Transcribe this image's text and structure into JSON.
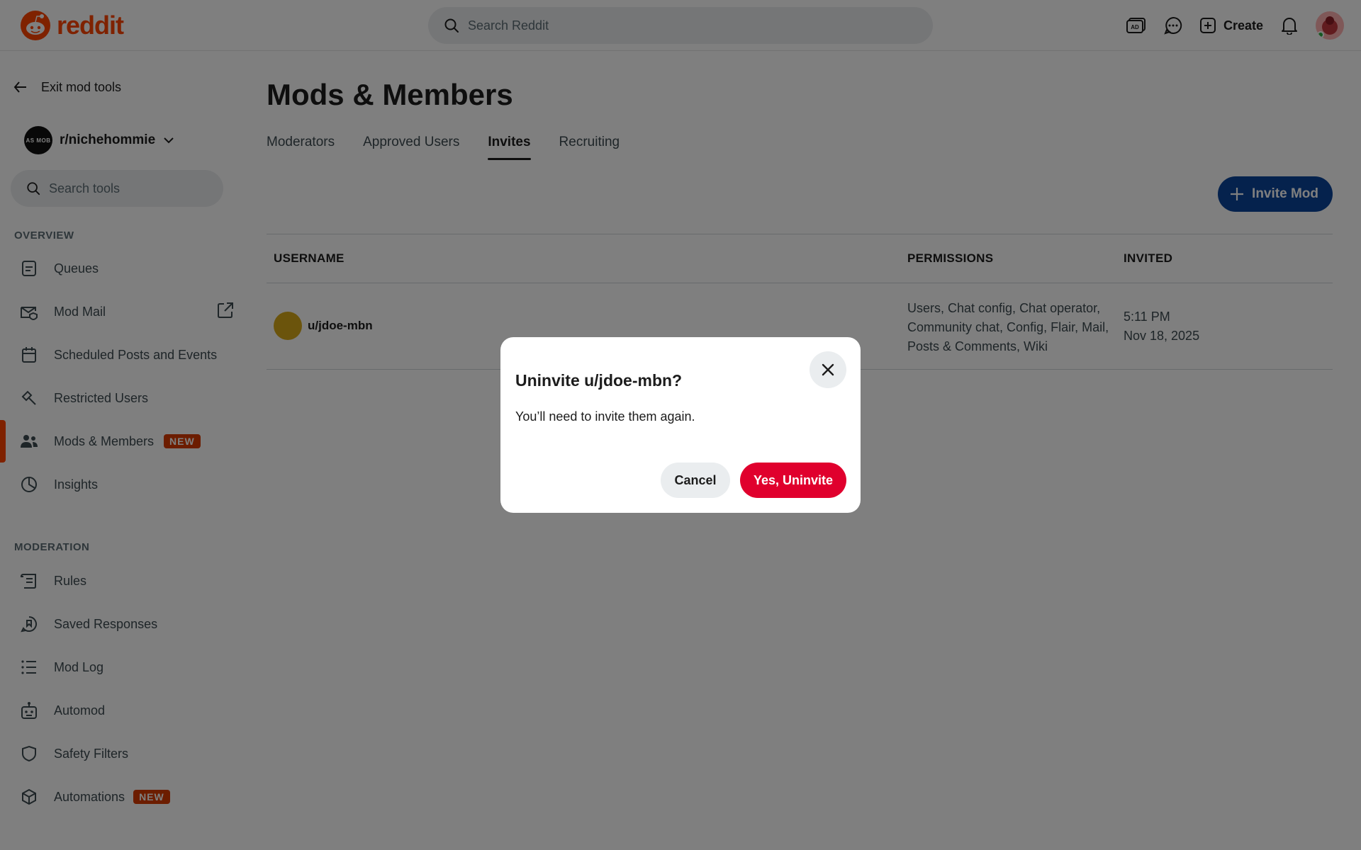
{
  "header": {
    "logo_text": "reddit",
    "search_placeholder": "Search Reddit",
    "create_label": "Create"
  },
  "sidebar": {
    "exit_label": "Exit mod tools",
    "subreddit": "r/nichehommie",
    "subreddit_avatar_text": "AS MOB",
    "search_placeholder": "Search tools",
    "overview_heading": "OVERVIEW",
    "moderation_heading": "MODERATION",
    "badge_new": "NEW",
    "overview_items": [
      {
        "label": "Queues",
        "icon": "queue-icon"
      },
      {
        "label": "Mod Mail",
        "icon": "mail-icon"
      },
      {
        "label": "Scheduled Posts and Events",
        "icon": "calendar-icon"
      },
      {
        "label": "Restricted Users",
        "icon": "hammer-icon"
      },
      {
        "label": "Mods & Members",
        "icon": "users-icon"
      },
      {
        "label": "Insights",
        "icon": "pie-chart-icon"
      }
    ],
    "moderation_items": [
      {
        "label": "Rules",
        "icon": "rules-icon"
      },
      {
        "label": "Saved Responses",
        "icon": "saved-responses-icon"
      },
      {
        "label": "Mod Log",
        "icon": "list-icon"
      },
      {
        "label": "Automod",
        "icon": "robot-icon"
      },
      {
        "label": "Safety Filters",
        "icon": "shield-icon"
      },
      {
        "label": "Automations",
        "icon": "cube-icon"
      }
    ]
  },
  "main": {
    "title": "Mods & Members",
    "tabs": [
      "Moderators",
      "Approved Users",
      "Invites",
      "Recruiting"
    ],
    "active_tab": "Invites",
    "invite_button": "Invite Mod",
    "columns": {
      "username": "USERNAME",
      "permissions": "PERMISSIONS",
      "invited": "INVITED"
    },
    "rows": [
      {
        "username": "u/jdoe-mbn",
        "permissions_line1": "Users, Chat config, Chat operator,",
        "permissions_line2": "Community chat, Config, Flair, Mail,",
        "permissions_line3": "Posts & Comments, Wiki",
        "invited_time": "5:11 PM",
        "invited_date": "Nov 18, 2025"
      }
    ]
  },
  "modal": {
    "title": "Uninvite u/jdoe-mbn?",
    "body": "You’ll need to invite them again.",
    "cancel_label": "Cancel",
    "confirm_label": "Yes, Uninvite"
  },
  "colors": {
    "brand": "#ff4500",
    "primary_button": "#0a449b",
    "danger_button": "#e0002d",
    "badge_new": "#d93a00"
  }
}
